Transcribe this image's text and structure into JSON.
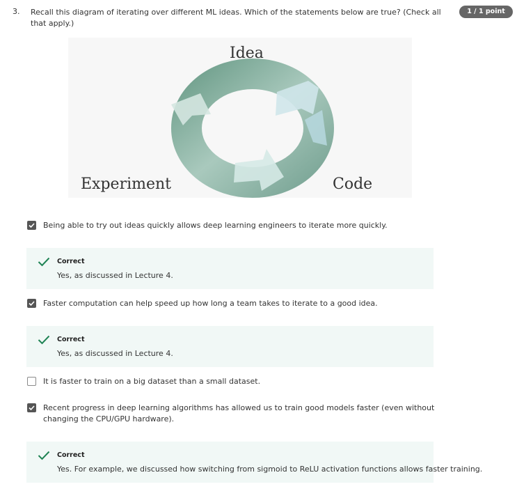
{
  "question": {
    "number": "3.",
    "text": "Recall this diagram of iterating over different ML ideas. Which of the statements below are true? (Check all that apply.)",
    "score": "1 / 1 point"
  },
  "diagram": {
    "labels": {
      "top": "Idea",
      "left": "Experiment",
      "right": "Code"
    }
  },
  "options": [
    {
      "text": "Being able to try out ideas quickly allows deep learning engineers to iterate more quickly.",
      "checked": true,
      "feedback": {
        "title": "Correct",
        "message": "Yes, as discussed in Lecture 4."
      }
    },
    {
      "text": "Faster computation can help speed up how long a team takes to iterate to a good idea.",
      "checked": true,
      "feedback": {
        "title": "Correct",
        "message": "Yes, as discussed in Lecture 4."
      }
    },
    {
      "text": "It is faster to train on a big dataset than a small dataset.",
      "checked": false
    },
    {
      "text": "Recent progress in deep learning algorithms has allowed us to train good models faster (even without changing the CPU/GPU hardware).",
      "checked": true,
      "feedback": {
        "title": "Correct",
        "message": "Yes. For example, we discussed how switching from sigmoid to ReLU activation functions allows faster training."
      }
    }
  ],
  "colors": {
    "badge": "#666666",
    "feedback_bg": "#f1f8f6",
    "check_green": "#1f8354",
    "checkbox_on": "#555555"
  },
  "icons": [
    "checkmark-icon",
    "checkbox-icon"
  ]
}
